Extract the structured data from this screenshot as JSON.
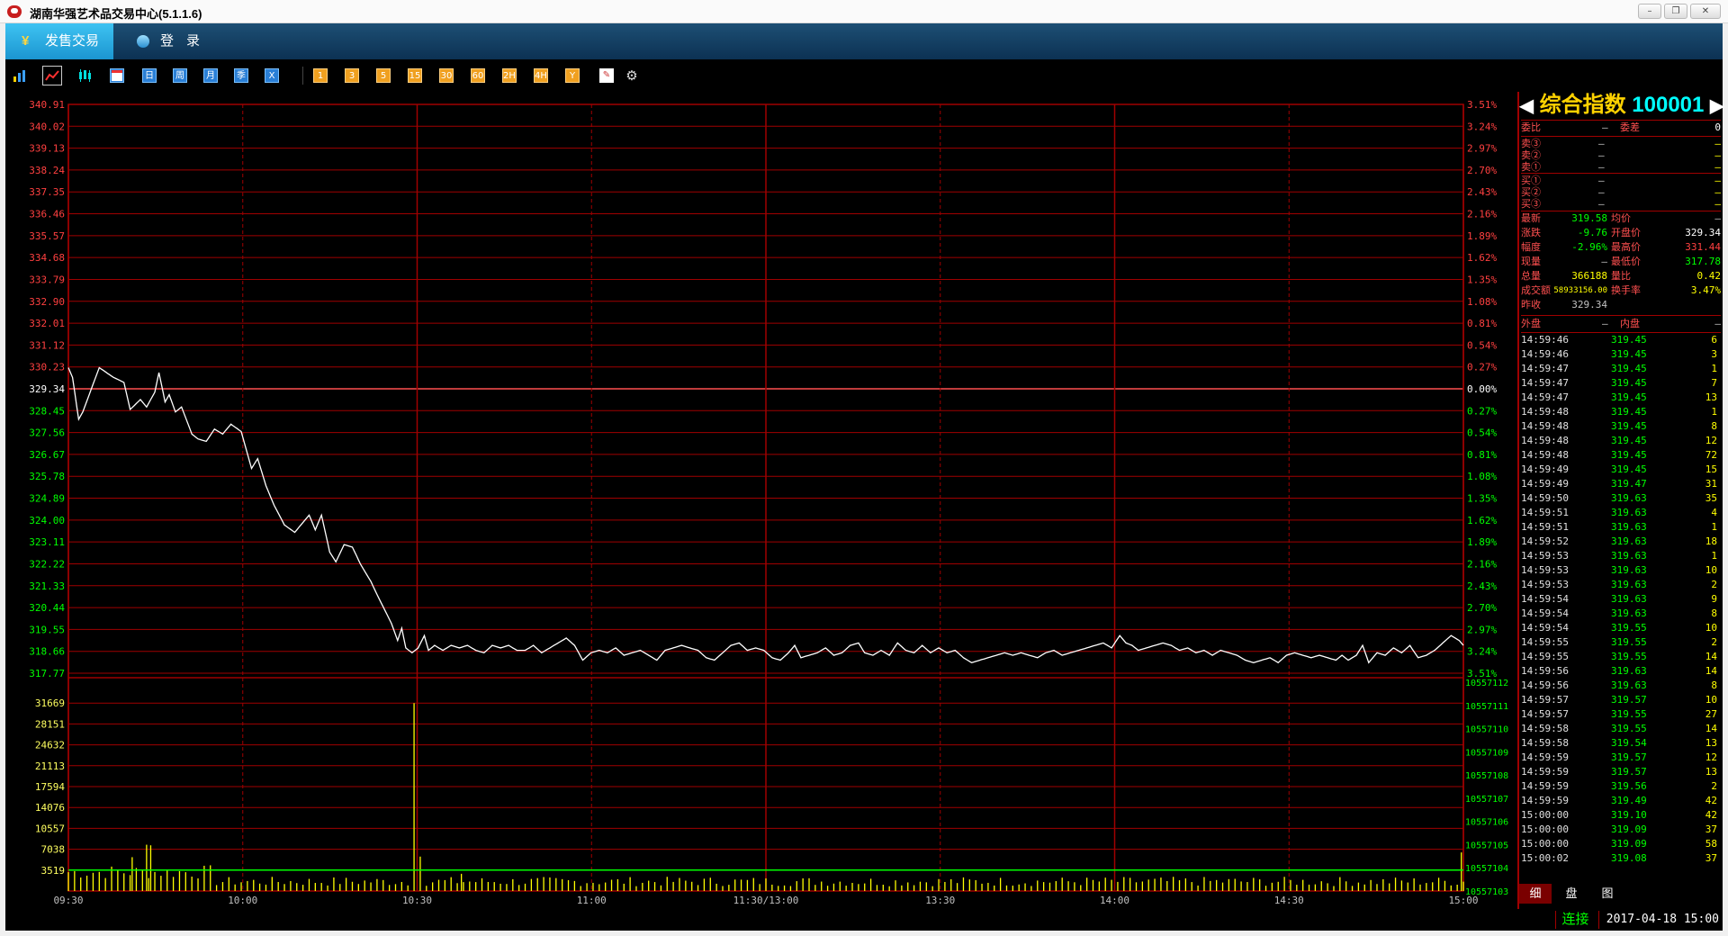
{
  "window": {
    "title": "湖南华强艺术品交易中心(5.1.1.6)",
    "controls": [
      "–",
      "❐",
      "✕"
    ]
  },
  "menubar": {
    "sales_tab": "发售交易",
    "login": "登录"
  },
  "toolbar": {
    "chart_icons": [
      "bar-chart-icon",
      "line-chart-icon",
      "candle-chart-icon"
    ],
    "period_calendar": [
      "日",
      "周",
      "月",
      "季",
      "X"
    ],
    "period_minutes": [
      "1",
      "3",
      "5",
      "15",
      "30",
      "60",
      "2H",
      "4H",
      "Y"
    ]
  },
  "chart_data": {
    "type": "line",
    "prev_close": 329.34,
    "price_axis": {
      "labels": [
        "340.91",
        "340.02",
        "339.13",
        "338.24",
        "337.35",
        "336.46",
        "335.57",
        "334.68",
        "333.79",
        "332.90",
        "332.01",
        "331.12",
        "330.23",
        "329.34",
        "328.45",
        "327.56",
        "326.67",
        "325.78",
        "324.89",
        "324.00",
        "323.11",
        "322.22",
        "321.33",
        "320.44",
        "319.55",
        "318.66",
        "317.77"
      ],
      "ylim": [
        317.77,
        340.91
      ]
    },
    "pct_axis": {
      "labels": [
        "3.51%",
        "3.24%",
        "2.97%",
        "2.70%",
        "2.43%",
        "2.16%",
        "1.89%",
        "1.62%",
        "1.35%",
        "1.08%",
        "0.81%",
        "0.54%",
        "0.27%",
        "0.00%",
        "0.27%",
        "0.54%",
        "0.81%",
        "1.08%",
        "1.35%",
        "1.62%",
        "1.89%",
        "2.16%",
        "2.43%",
        "2.70%",
        "2.97%",
        "3.24%",
        "3.51%"
      ]
    },
    "volume_axis": {
      "labels": [
        "31669",
        "28151",
        "24632",
        "21113",
        "17594",
        "14076",
        "10557",
        "7038",
        "3519"
      ],
      "ylim": [
        0,
        35188
      ]
    },
    "oi_axis": {
      "labels": [
        "10557112",
        "10557111",
        "10557110",
        "10557109",
        "10557108",
        "10557107",
        "10557106",
        "10557105",
        "10557104",
        "10557103"
      ]
    },
    "time_axis": {
      "labels": [
        "09:30",
        "10:00",
        "10:30",
        "11:00",
        "11:30/13:00",
        "13:30",
        "14:00",
        "14:30",
        "15:00"
      ]
    },
    "price_series_keyframes": [
      [
        0,
        330.2
      ],
      [
        2,
        329.8
      ],
      [
        5,
        328.1
      ],
      [
        7,
        328.4
      ],
      [
        15,
        330.2
      ],
      [
        22,
        329.8
      ],
      [
        27,
        329.6
      ],
      [
        30,
        328.5
      ],
      [
        35,
        328.9
      ],
      [
        38,
        328.6
      ],
      [
        42,
        329.2
      ],
      [
        44,
        330.0
      ],
      [
        47,
        328.8
      ],
      [
        49,
        329.1
      ],
      [
        52,
        328.4
      ],
      [
        55,
        328.6
      ],
      [
        60,
        327.5
      ],
      [
        63,
        327.3
      ],
      [
        67,
        327.2
      ],
      [
        71,
        327.7
      ],
      [
        75,
        327.5
      ],
      [
        79,
        327.9
      ],
      [
        84,
        327.6
      ],
      [
        86,
        327.0
      ],
      [
        89,
        326.1
      ],
      [
        92,
        326.5
      ],
      [
        96,
        325.4
      ],
      [
        100,
        324.6
      ],
      [
        105,
        323.8
      ],
      [
        110,
        323.5
      ],
      [
        114,
        323.9
      ],
      [
        117,
        324.2
      ],
      [
        120,
        323.6
      ],
      [
        123,
        324.2
      ],
      [
        127,
        322.7
      ],
      [
        130,
        322.3
      ],
      [
        134,
        323.0
      ],
      [
        138,
        322.9
      ],
      [
        142,
        322.2
      ],
      [
        147,
        321.5
      ],
      [
        151,
        320.8
      ],
      [
        154,
        320.3
      ],
      [
        157,
        319.8
      ],
      [
        160,
        319.1
      ],
      [
        162,
        319.6
      ],
      [
        164,
        318.8
      ],
      [
        167,
        318.6
      ],
      [
        170,
        318.8
      ],
      [
        173,
        319.3
      ],
      [
        175,
        318.7
      ],
      [
        178,
        318.9
      ],
      [
        182,
        318.7
      ],
      [
        186,
        318.9
      ],
      [
        190,
        318.8
      ],
      [
        194,
        318.9
      ],
      [
        198,
        318.7
      ],
      [
        202,
        318.6
      ],
      [
        206,
        318.9
      ],
      [
        210,
        318.8
      ],
      [
        214,
        318.9
      ],
      [
        218,
        318.7
      ],
      [
        222,
        318.7
      ],
      [
        226,
        318.9
      ],
      [
        230,
        318.6
      ],
      [
        234,
        318.8
      ],
      [
        238,
        319.0
      ],
      [
        242,
        319.2
      ],
      [
        246,
        318.9
      ],
      [
        250,
        318.3
      ],
      [
        254,
        318.6
      ],
      [
        258,
        318.7
      ],
      [
        262,
        318.6
      ],
      [
        266,
        318.8
      ],
      [
        270,
        318.5
      ],
      [
        274,
        318.6
      ],
      [
        278,
        318.7
      ],
      [
        282,
        318.5
      ],
      [
        286,
        318.3
      ],
      [
        290,
        318.7
      ],
      [
        294,
        318.8
      ],
      [
        298,
        318.9
      ],
      [
        302,
        318.8
      ],
      [
        306,
        318.7
      ],
      [
        310,
        318.4
      ],
      [
        314,
        318.3
      ],
      [
        318,
        318.6
      ],
      [
        322,
        318.9
      ],
      [
        326,
        319.0
      ],
      [
        330,
        318.7
      ],
      [
        334,
        318.8
      ],
      [
        338,
        318.7
      ],
      [
        342,
        318.4
      ],
      [
        346,
        318.3
      ],
      [
        350,
        318.6
      ],
      [
        353,
        318.9
      ],
      [
        356,
        318.4
      ],
      [
        360,
        318.5
      ],
      [
        364,
        318.6
      ],
      [
        368,
        318.8
      ],
      [
        372,
        318.5
      ],
      [
        376,
        318.6
      ],
      [
        380,
        318.9
      ],
      [
        384,
        319.0
      ],
      [
        387,
        318.6
      ],
      [
        391,
        318.5
      ],
      [
        395,
        318.7
      ],
      [
        399,
        318.5
      ],
      [
        403,
        319.0
      ],
      [
        407,
        318.7
      ],
      [
        411,
        318.6
      ],
      [
        415,
        318.9
      ],
      [
        419,
        318.6
      ],
      [
        423,
        318.8
      ],
      [
        427,
        318.6
      ],
      [
        431,
        318.7
      ],
      [
        435,
        318.4
      ],
      [
        439,
        318.2
      ],
      [
        443,
        318.3
      ],
      [
        447,
        318.4
      ],
      [
        451,
        318.5
      ],
      [
        455,
        318.6
      ],
      [
        459,
        318.5
      ],
      [
        463,
        318.6
      ],
      [
        467,
        318.5
      ],
      [
        471,
        318.4
      ],
      [
        475,
        318.6
      ],
      [
        479,
        318.7
      ],
      [
        483,
        318.5
      ],
      [
        487,
        318.6
      ],
      [
        491,
        318.7
      ],
      [
        495,
        318.8
      ],
      [
        499,
        318.9
      ],
      [
        503,
        319.0
      ],
      [
        507,
        318.8
      ],
      [
        511,
        319.3
      ],
      [
        514,
        319.0
      ],
      [
        517,
        318.9
      ],
      [
        520,
        318.7
      ],
      [
        524,
        318.8
      ],
      [
        528,
        318.9
      ],
      [
        532,
        319.0
      ],
      [
        536,
        318.9
      ],
      [
        540,
        318.7
      ],
      [
        544,
        318.8
      ],
      [
        548,
        318.6
      ],
      [
        552,
        318.7
      ],
      [
        556,
        318.5
      ],
      [
        560,
        318.7
      ],
      [
        564,
        318.6
      ],
      [
        568,
        318.5
      ],
      [
        572,
        318.3
      ],
      [
        576,
        318.2
      ],
      [
        580,
        318.3
      ],
      [
        584,
        318.4
      ],
      [
        588,
        318.2
      ],
      [
        592,
        318.5
      ],
      [
        596,
        318.6
      ],
      [
        600,
        318.5
      ],
      [
        604,
        318.4
      ],
      [
        608,
        318.5
      ],
      [
        612,
        318.4
      ],
      [
        616,
        318.3
      ],
      [
        619,
        318.5
      ],
      [
        622,
        318.3
      ],
      [
        626,
        318.5
      ],
      [
        629,
        318.9
      ],
      [
        632,
        318.2
      ],
      [
        636,
        318.6
      ],
      [
        640,
        318.5
      ],
      [
        644,
        318.8
      ],
      [
        648,
        318.6
      ],
      [
        652,
        318.9
      ],
      [
        656,
        318.4
      ],
      [
        660,
        318.5
      ],
      [
        664,
        318.7
      ],
      [
        668,
        319.0
      ],
      [
        672,
        319.3
      ],
      [
        676,
        319.1
      ],
      [
        678,
        318.9
      ]
    ],
    "volume_spikes": [
      [
        38,
        7800
      ],
      [
        40,
        7700
      ],
      [
        31,
        5700
      ],
      [
        168,
        31669
      ],
      [
        171,
        5800
      ],
      [
        191,
        2900
      ],
      [
        677,
        6500
      ]
    ]
  },
  "quote_panel": {
    "title": "综合指数",
    "code": "100001",
    "weibi_label": "委比",
    "weibi_value": "—",
    "weicha_label": "委差",
    "weicha_value": "0",
    "asks": [
      {
        "label": "卖③",
        "price": "—",
        "vol": "—"
      },
      {
        "label": "卖②",
        "price": "—",
        "vol": "—"
      },
      {
        "label": "卖①",
        "price": "—",
        "vol": "—"
      }
    ],
    "bids": [
      {
        "label": "买①",
        "price": "—",
        "vol": "—"
      },
      {
        "label": "买②",
        "price": "—",
        "vol": "—"
      },
      {
        "label": "买③",
        "price": "—",
        "vol": "—"
      }
    ],
    "stats": [
      {
        "l1": "最新",
        "v1": "319.58",
        "c1": "#00ff00",
        "l2": "均价",
        "v2": "—",
        "c2": "#c0c0c0"
      },
      {
        "l1": "涨跌",
        "v1": "-9.76",
        "c1": "#00ff00",
        "l2": "开盘价",
        "v2": "329.34",
        "c2": "#ffffff"
      },
      {
        "l1": "幅度",
        "v1": "-2.96%",
        "c1": "#00ff00",
        "l2": "最高价",
        "v2": "331.44",
        "c2": "#ff4040"
      },
      {
        "l1": "现量",
        "v1": "—",
        "c1": "#c0c0c0",
        "l2": "最低价",
        "v2": "317.78",
        "c2": "#00ff00"
      },
      {
        "l1": "总量",
        "v1": "366188",
        "c1": "#ffff00",
        "l2": "量比",
        "v2": "0.42",
        "c2": "#ffff00"
      },
      {
        "l1": "成交额",
        "v1": "58933156.00",
        "c1": "#ffff00",
        "l2": "换手率",
        "v2": "3.47%",
        "c2": "#ffff00"
      },
      {
        "l1": "昨收",
        "v1": "329.34",
        "c1": "#c0c0c0",
        "l2": "",
        "v2": "",
        "c2": "#c0c0c0"
      }
    ],
    "waipan_label": "外盘",
    "waipan_value": "—",
    "neipan_label": "内盘",
    "neipan_value": "—",
    "ticks": [
      [
        "14:59:46",
        "319.45",
        "6"
      ],
      [
        "14:59:46",
        "319.45",
        "3"
      ],
      [
        "14:59:47",
        "319.45",
        "1"
      ],
      [
        "14:59:47",
        "319.45",
        "7"
      ],
      [
        "14:59:47",
        "319.45",
        "13"
      ],
      [
        "14:59:48",
        "319.45",
        "1"
      ],
      [
        "14:59:48",
        "319.45",
        "8"
      ],
      [
        "14:59:48",
        "319.45",
        "12"
      ],
      [
        "14:59:48",
        "319.45",
        "72"
      ],
      [
        "14:59:49",
        "319.45",
        "15"
      ],
      [
        "14:59:49",
        "319.47",
        "31"
      ],
      [
        "14:59:50",
        "319.63",
        "35"
      ],
      [
        "14:59:51",
        "319.63",
        "4"
      ],
      [
        "14:59:51",
        "319.63",
        "1"
      ],
      [
        "14:59:52",
        "319.63",
        "18"
      ],
      [
        "14:59:53",
        "319.63",
        "1"
      ],
      [
        "14:59:53",
        "319.63",
        "10"
      ],
      [
        "14:59:53",
        "319.63",
        "2"
      ],
      [
        "14:59:54",
        "319.63",
        "9"
      ],
      [
        "14:59:54",
        "319.63",
        "8"
      ],
      [
        "14:59:54",
        "319.55",
        "10"
      ],
      [
        "14:59:55",
        "319.55",
        "2"
      ],
      [
        "14:59:55",
        "319.55",
        "14"
      ],
      [
        "14:59:56",
        "319.63",
        "14"
      ],
      [
        "14:59:56",
        "319.63",
        "8"
      ],
      [
        "14:59:57",
        "319.57",
        "10"
      ],
      [
        "14:59:57",
        "319.55",
        "27"
      ],
      [
        "14:59:58",
        "319.55",
        "14"
      ],
      [
        "14:59:58",
        "319.54",
        "13"
      ],
      [
        "14:59:59",
        "319.57",
        "12"
      ],
      [
        "14:59:59",
        "319.57",
        "13"
      ],
      [
        "14:59:59",
        "319.56",
        "2"
      ],
      [
        "14:59:59",
        "319.49",
        "42"
      ],
      [
        "15:00:00",
        "319.10",
        "42"
      ],
      [
        "15:00:00",
        "319.09",
        "37"
      ],
      [
        "15:00:00",
        "319.09",
        "58"
      ],
      [
        "15:00:02",
        "319.08",
        "37"
      ]
    ],
    "bottom_tabs": [
      "细",
      "盘",
      "图"
    ]
  },
  "status": {
    "connection": "连接",
    "datetime": "2017-04-18 15:00"
  },
  "colors": {
    "grid": "#a00000",
    "up": "#ff4040",
    "down": "#00ff00",
    "line": "#ffffff",
    "volume": "#ffff00",
    "oi": "#00ff00",
    "accent": "#ffd200"
  }
}
